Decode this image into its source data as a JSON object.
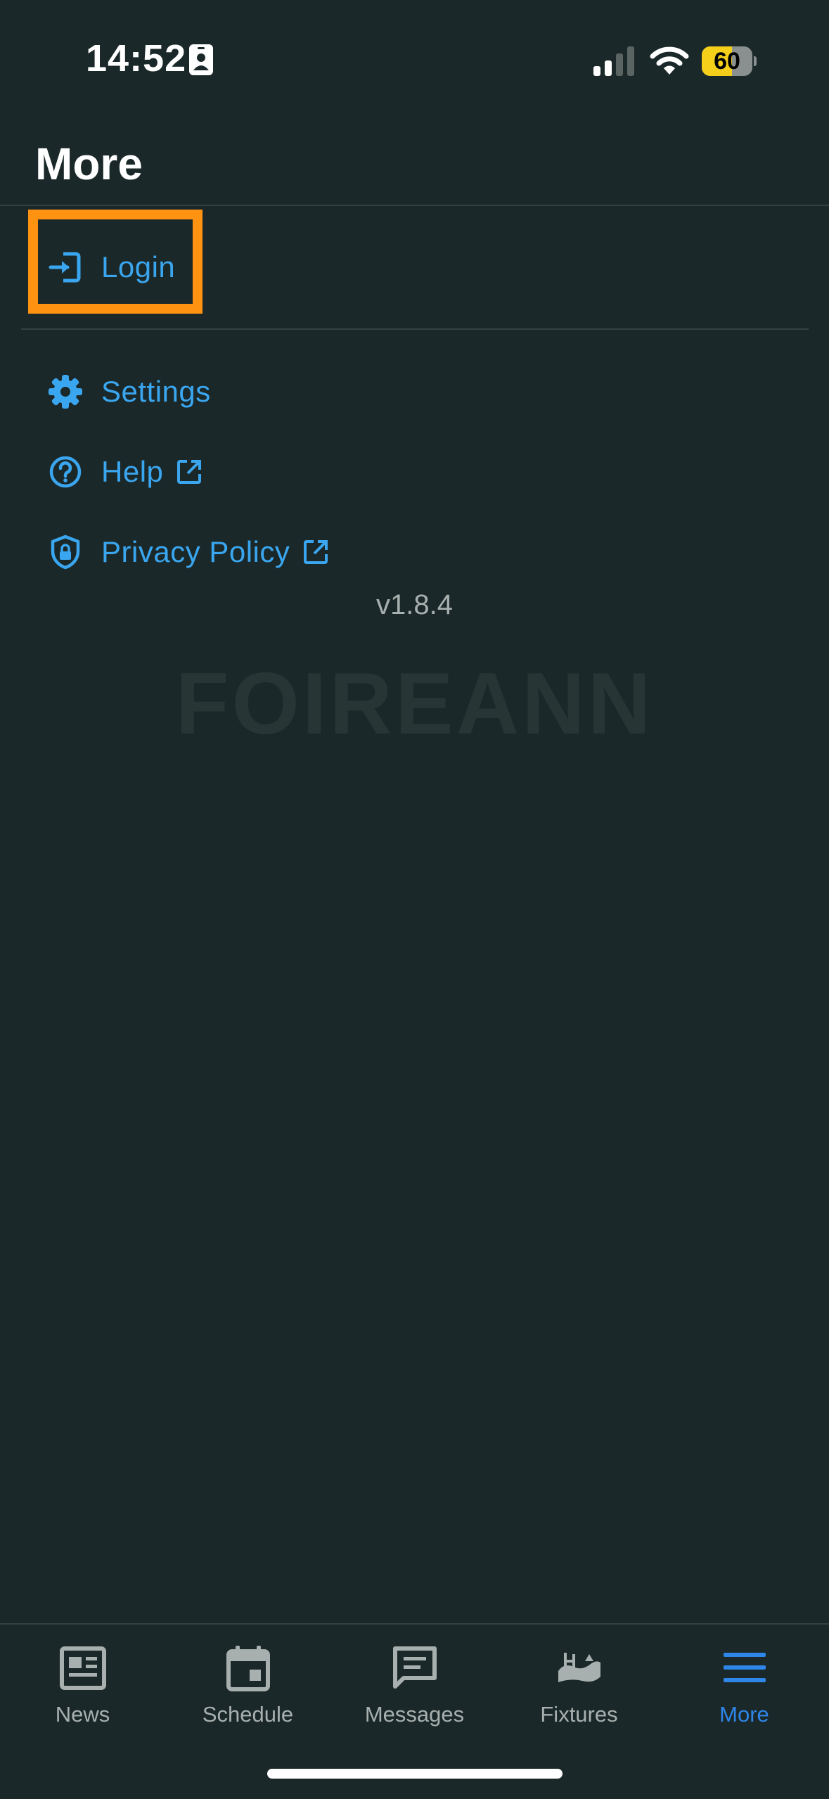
{
  "status_bar": {
    "time": "14:52",
    "battery_level": "60",
    "battery_fraction": 0.6,
    "battery_color": "#f6cf1a",
    "icons": [
      "id-card-icon",
      "signal-icon",
      "wifi-icon",
      "battery-icon"
    ]
  },
  "header": {
    "title": "More"
  },
  "menu": {
    "login": {
      "label": "Login",
      "icon": "login-icon",
      "highlighted": true,
      "highlight_color": "#ff9210"
    },
    "settings": {
      "label": "Settings",
      "icon": "gear-icon"
    },
    "help": {
      "label": "Help",
      "icon": "help-circle-icon",
      "external": true
    },
    "privacy": {
      "label": "Privacy Policy",
      "icon": "shield-lock-icon",
      "external": true
    },
    "link_color": "#3aa6ef"
  },
  "version": "v1.8.4",
  "watermark": "FOIREANN",
  "tab_bar": {
    "tabs": [
      {
        "label": "News",
        "icon": "newspaper-icon"
      },
      {
        "label": "Schedule",
        "icon": "calendar-icon"
      },
      {
        "label": "Messages",
        "icon": "message-icon"
      },
      {
        "label": "Fixtures",
        "icon": "pitch-icon"
      },
      {
        "label": "More",
        "icon": "menu-icon",
        "active": true
      }
    ],
    "active_color": "#2e86e8",
    "inactive_color": "#a7b0ae"
  }
}
